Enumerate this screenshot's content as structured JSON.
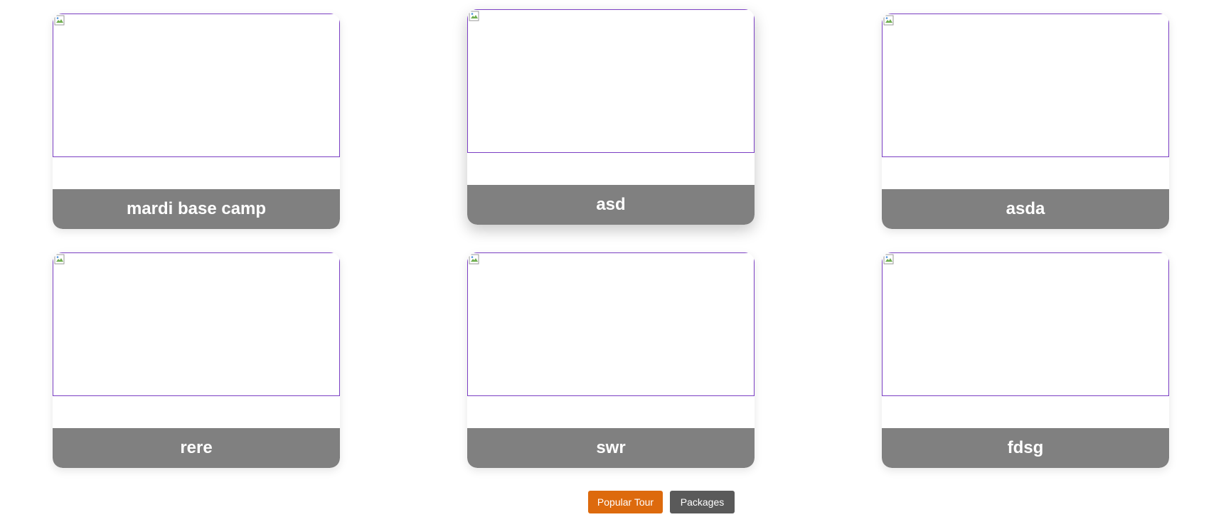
{
  "cards": [
    {
      "title": "mardi base camp"
    },
    {
      "title": "asd"
    },
    {
      "title": "asda"
    },
    {
      "title": "rere"
    },
    {
      "title": "swr"
    },
    {
      "title": "fdsg"
    }
  ],
  "buttons": {
    "popular_tour": "Popular Tour",
    "packages": "Packages"
  },
  "colors": {
    "caption_bg": "#808080",
    "image_border": "#7b3fc4",
    "popular_tour_bg": "#dd6a0d",
    "packages_bg": "#5a5a5a"
  },
  "icons": {
    "image_placeholder": "broken-image-icon"
  }
}
